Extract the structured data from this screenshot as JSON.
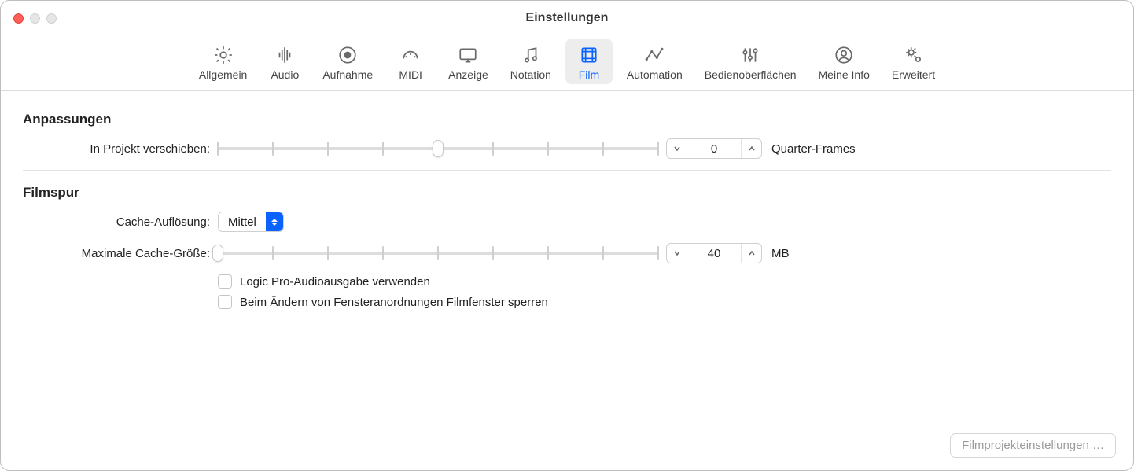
{
  "window": {
    "title": "Einstellungen"
  },
  "toolbar": {
    "items": [
      {
        "id": "allgemein",
        "label": "Allgemein"
      },
      {
        "id": "audio",
        "label": "Audio"
      },
      {
        "id": "aufnahme",
        "label": "Aufnahme"
      },
      {
        "id": "midi",
        "label": "MIDI"
      },
      {
        "id": "anzeige",
        "label": "Anzeige"
      },
      {
        "id": "notation",
        "label": "Notation"
      },
      {
        "id": "film",
        "label": "Film",
        "selected": true
      },
      {
        "id": "automation",
        "label": "Automation"
      },
      {
        "id": "bedienoberflaechen",
        "label": "Bedienoberflächen"
      },
      {
        "id": "meine-info",
        "label": "Meine Info"
      },
      {
        "id": "erweitert",
        "label": "Erweitert"
      }
    ]
  },
  "sections": {
    "anpassungen": {
      "title": "Anpassungen",
      "in_projekt": {
        "label": "In Projekt verschieben:",
        "slider": {
          "ticks": 9,
          "knob_index": 4
        },
        "value": "0",
        "unit": "Quarter-Frames"
      }
    },
    "filmspur": {
      "title": "Filmspur",
      "cache_aufloesung": {
        "label": "Cache-Auflösung:",
        "selected": "Mittel"
      },
      "max_cache": {
        "label": "Maximale Cache-Größe:",
        "slider": {
          "ticks": 9,
          "knob_index": 0
        },
        "value": "40",
        "unit": "MB"
      },
      "checkbox_audio": {
        "label": "Logic Pro-Audioausgabe verwenden",
        "checked": false
      },
      "checkbox_lock": {
        "label": "Beim Ändern von Fensteranordnungen Filmfenster sperren",
        "checked": false
      }
    }
  },
  "footer": {
    "button": "Filmprojekteinstellungen …"
  }
}
